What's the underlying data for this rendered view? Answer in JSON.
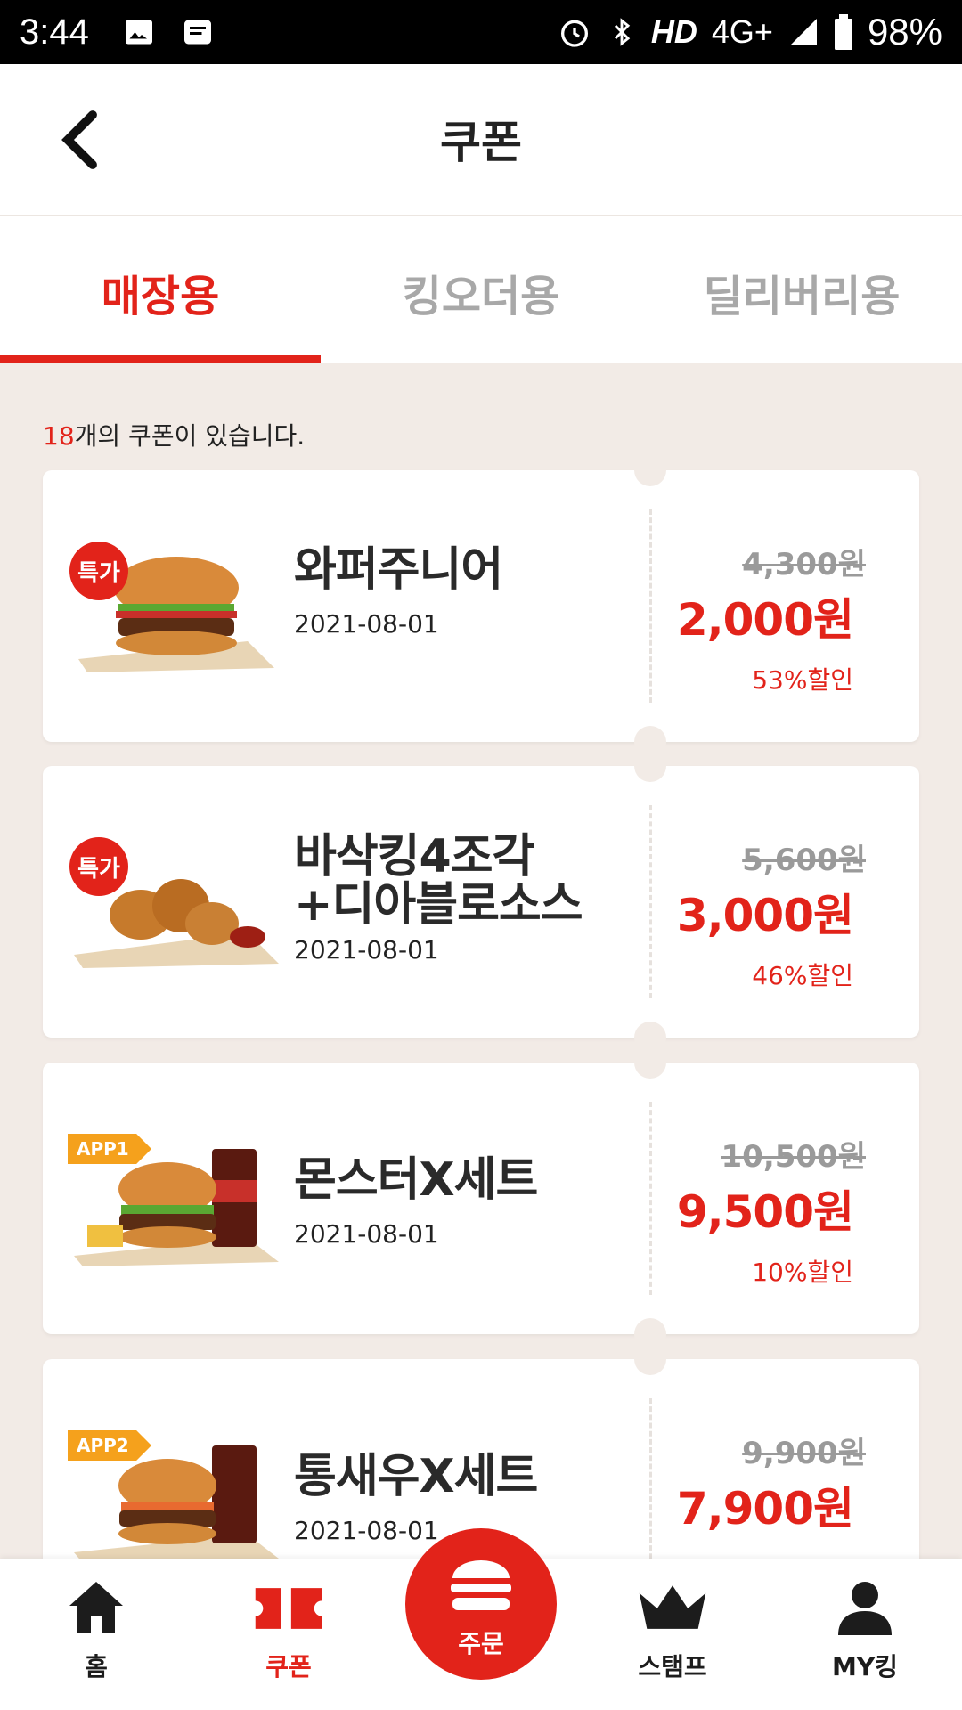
{
  "status_bar": {
    "time": "3:44",
    "network": "HD",
    "signal": "4G+",
    "battery": "98%",
    "icons": [
      "image-icon",
      "message-icon",
      "alarm-icon",
      "bluetooth-icon",
      "signal-icon",
      "battery-icon"
    ]
  },
  "header": {
    "title": "쿠폰"
  },
  "tabs": [
    {
      "label": "매장용",
      "active": true
    },
    {
      "label": "킹오더용",
      "active": false
    },
    {
      "label": "딜리버리용",
      "active": false
    }
  ],
  "coupon_count": {
    "number": "18",
    "suffix": "개의 쿠폰이 있습니다."
  },
  "coupons": [
    {
      "badge": "특가",
      "name_line1": "와퍼주니어",
      "name_line2": "",
      "date": "2021-08-01",
      "original_price": "4,300원",
      "price": "2,000원",
      "discount": "53%할인"
    },
    {
      "badge": "특가",
      "name_line1": "바삭킹4조각",
      "name_line2": "+디아블로소스",
      "date": "2021-08-01",
      "original_price": "5,600원",
      "price": "3,000원",
      "discount": "46%할인"
    },
    {
      "badge": "APP1",
      "name_line1": "몬스터X세트",
      "name_line2": "",
      "date": "2021-08-01",
      "original_price": "10,500원",
      "price": "9,500원",
      "discount": "10%할인"
    },
    {
      "badge": "APP2",
      "name_line1": "통새우X세트",
      "name_line2": "",
      "date": "2021-08-01",
      "original_price": "9,900원",
      "price": "7,900원",
      "discount": ""
    }
  ],
  "bottom_nav": {
    "home": "홈",
    "coupon": "쿠폰",
    "order": "주문",
    "stamp": "스탬프",
    "myking": "MY킹"
  },
  "colors": {
    "accent": "#e2231a",
    "background": "#f2ebe6",
    "app_badge": "#f5a11c"
  }
}
